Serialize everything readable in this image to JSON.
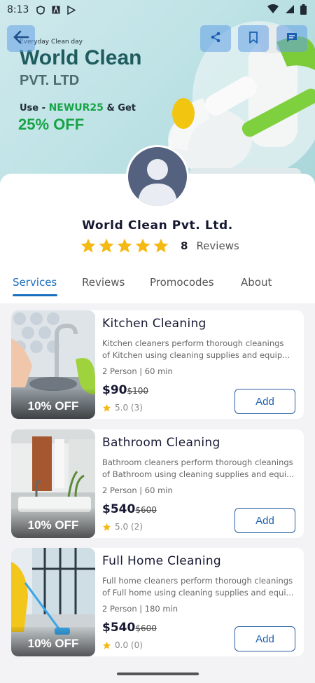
{
  "status_bar": {
    "time": "8:13"
  },
  "banner": {
    "tagline": "Everyday Clean day",
    "title": "World Clean",
    "subtitle": "PVT. LTD",
    "promo_prefix": "Use - ",
    "promo_code": "NEWUR25",
    "promo_suffix": " & Get",
    "offer": "25% OFF"
  },
  "company": {
    "name": "World Clean Pvt. Ltd.",
    "rating_stars": 5,
    "review_count": "8",
    "reviews_label": "Reviews"
  },
  "tabs": [
    {
      "label": "Services",
      "active": true
    },
    {
      "label": "Reviews",
      "active": false
    },
    {
      "label": "Promocodes",
      "active": false
    },
    {
      "label": "About",
      "active": false
    }
  ],
  "services": [
    {
      "title": "Kitchen Cleaning",
      "desc_line1": "Kitchen cleaners perform thorough cleanings",
      "desc_line2": "of Kitchen using cleaning supplies and equip...",
      "meta": "2 Person | 60 min",
      "price": "$90",
      "old_price": "$100",
      "rating": "5.0 (3)",
      "offer": "10% OFF",
      "add_label": "Add"
    },
    {
      "title": "Bathroom Cleaning",
      "desc_line1": "Bathroom cleaners perform thorough cleanings",
      "desc_line2": "of Bathroom using cleaning supplies and equi...",
      "meta": "2 Person | 60 min",
      "price": "$540",
      "old_price": "$600",
      "rating": "5.0 (2)",
      "offer": "10% OFF",
      "add_label": "Add"
    },
    {
      "title": "Full Home Cleaning",
      "desc_line1": "Full home cleaners perform thorough cleanings",
      "desc_line2": "of Full home using cleaning supplies and equi...",
      "meta": "2 Person | 180 min",
      "price": "$540",
      "old_price": "$600",
      "rating": "0.0 (0)",
      "offer": "10% OFF",
      "add_label": "Add"
    }
  ],
  "colors": {
    "accent": "#1a6fbf",
    "star": "#f5b914",
    "promo_green": "#17a447"
  },
  "icons": [
    "back-arrow-icon",
    "share-icon",
    "bookmark-icon",
    "chat-icon",
    "star-icon"
  ]
}
